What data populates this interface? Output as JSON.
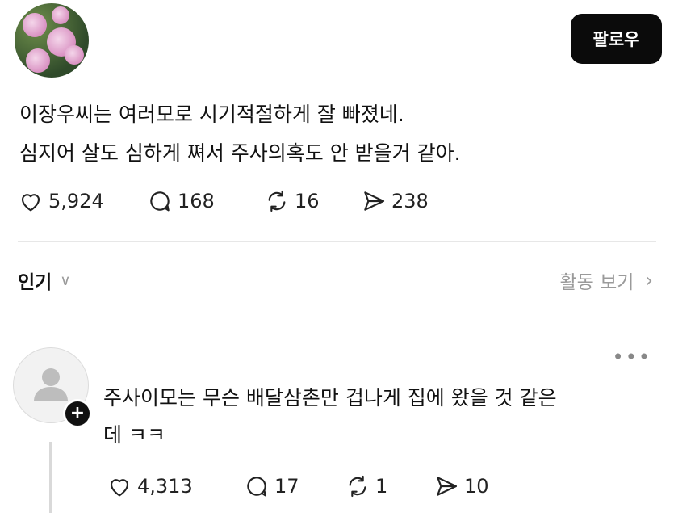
{
  "post": {
    "follow_label": "팔로우",
    "lines": [
      "이장우씨는 여러모로 시기적절하게 잘 빠졌네.",
      "심지어 살도 심하게 쪄서 주사의혹도 안 받을거 같아."
    ],
    "stats": {
      "likes": "5,924",
      "replies": "168",
      "reposts": "16",
      "shares": "238"
    }
  },
  "section": {
    "sort_label": "인기",
    "activity_label": "활동 보기"
  },
  "comment": {
    "lines": [
      "주사이모는 무슨 배달삼촌만 겁나게 집에 왔을 것 같은",
      "데 ㅋㅋ"
    ],
    "stats": {
      "likes": "4,313",
      "replies": "17",
      "reposts": "1",
      "shares": "10"
    }
  }
}
